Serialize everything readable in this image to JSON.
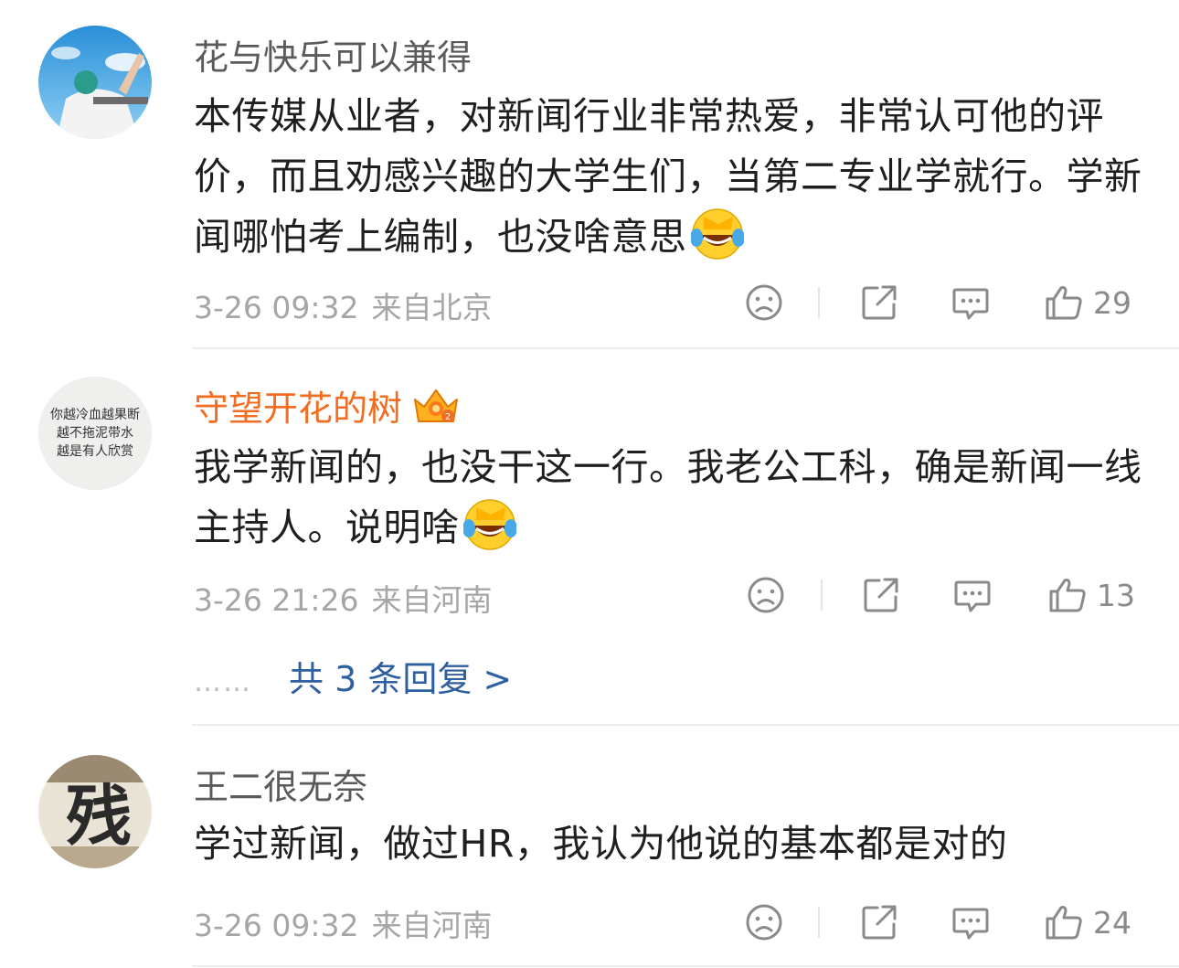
{
  "comments": [
    {
      "username": "花与快乐可以兼得",
      "text": "本传媒从业者，对新闻行业非常热爱，非常认可他的评价，而且劝感兴趣的大学生们，当第二专业学就行。学新闻哪怕考上编制，也没啥意思",
      "time": "3-26 09:32",
      "location": "来自北京",
      "likes": "29",
      "avatar_icon": "blue-sky-photo-avatar"
    },
    {
      "username": "守望开花的树",
      "text": "我学新闻的，也没干这一行。我老公工科，确是新闻一线主持人。说明啥",
      "time": "3-26 21:26",
      "location": "来自河南",
      "likes": "13",
      "avatar_lines": [
        "你越冷血越果断",
        "越不拖泥带水",
        "越是有人欣赏"
      ],
      "badge_icon": "vip-crown-icon",
      "replies_label": "共 3 条回复 >",
      "replies_dots": "……"
    },
    {
      "username": "王二很无奈",
      "text": "学过新闻，做过HR，我认为他说的基本都是对的",
      "time": "3-26 09:32",
      "location": "来自河南",
      "likes": "24",
      "avatar_glyph": "残"
    }
  ],
  "colors": {
    "vip_name": "#f26d21",
    "link": "#2e5fa0",
    "meta": "#a6a6a6"
  }
}
